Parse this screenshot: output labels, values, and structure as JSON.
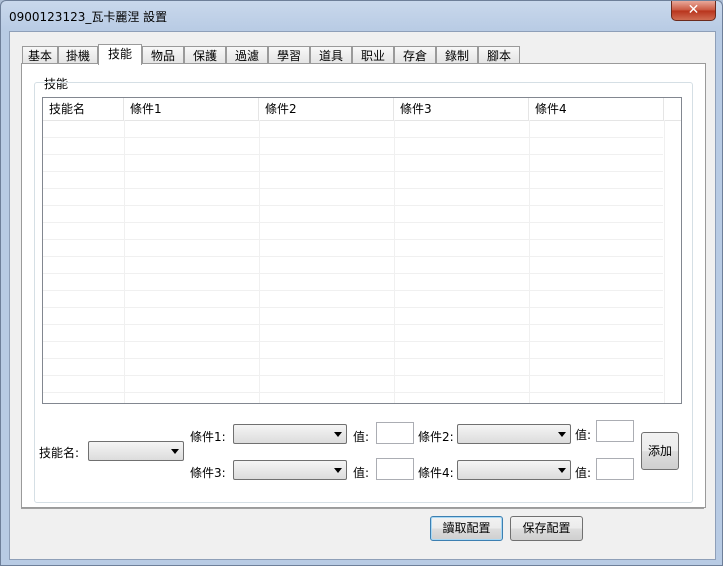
{
  "window": {
    "title": "0900123123_瓦卡麗涅  設置",
    "close_label": "✕"
  },
  "tabs": [
    "基本",
    "掛機",
    "技能",
    "物品",
    "保護",
    "過濾",
    "學習",
    "道具",
    "职业",
    "存倉",
    "錄制",
    "腳本"
  ],
  "active_tab": "技能",
  "skills_group": {
    "label": "技能",
    "columns": [
      "技能名",
      "條件1",
      "條件2",
      "條件3",
      "條件4"
    ]
  },
  "form": {
    "skill_name_label": "技能名:",
    "cond1_label": "條件1:",
    "cond2_label": "條件2:",
    "cond3_label": "條件3:",
    "cond4_label": "條件4:",
    "value_label": "值:",
    "add_button": "添加"
  },
  "footer": {
    "load_button": "讀取配置",
    "save_button": "保存配置"
  }
}
